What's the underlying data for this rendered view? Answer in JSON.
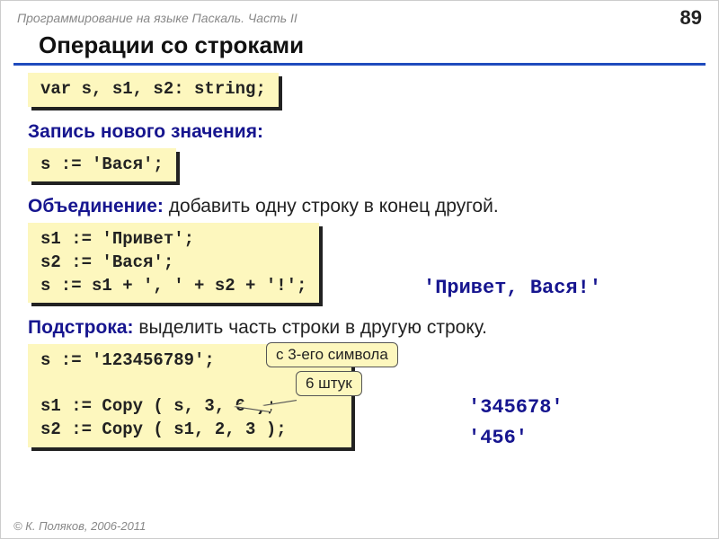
{
  "header": {
    "course": "Программирование на языке Паскаль. Часть II",
    "page": "89"
  },
  "title": "Операции со строками",
  "block1": {
    "code": "var s, s1, s2: string;"
  },
  "sec_assign": {
    "heading": "Запись нового значения:",
    "code": "s := 'Вася';"
  },
  "sec_concat": {
    "heading": "Объединение:",
    "desc": " добавить одну строку в конец другой.",
    "code": "s1 := 'Привет';\ns2 := 'Вася';\ns := s1 + ', ' + s2 + '!';",
    "result": "'Привет, Вася!'"
  },
  "sec_substr": {
    "heading": "Подстрока:",
    "desc": " выделить часть строки в другую строку.",
    "code": "s := '123456789';\n\ns1 := Copy ( s, 3, 6 );\ns2 := Copy ( s1, 2, 3 );",
    "callout1": "с 3-его символа",
    "callout2": "6 штук",
    "result1": "'345678'",
    "result2": "'456'"
  },
  "footer": "© К. Поляков, 2006-2011"
}
